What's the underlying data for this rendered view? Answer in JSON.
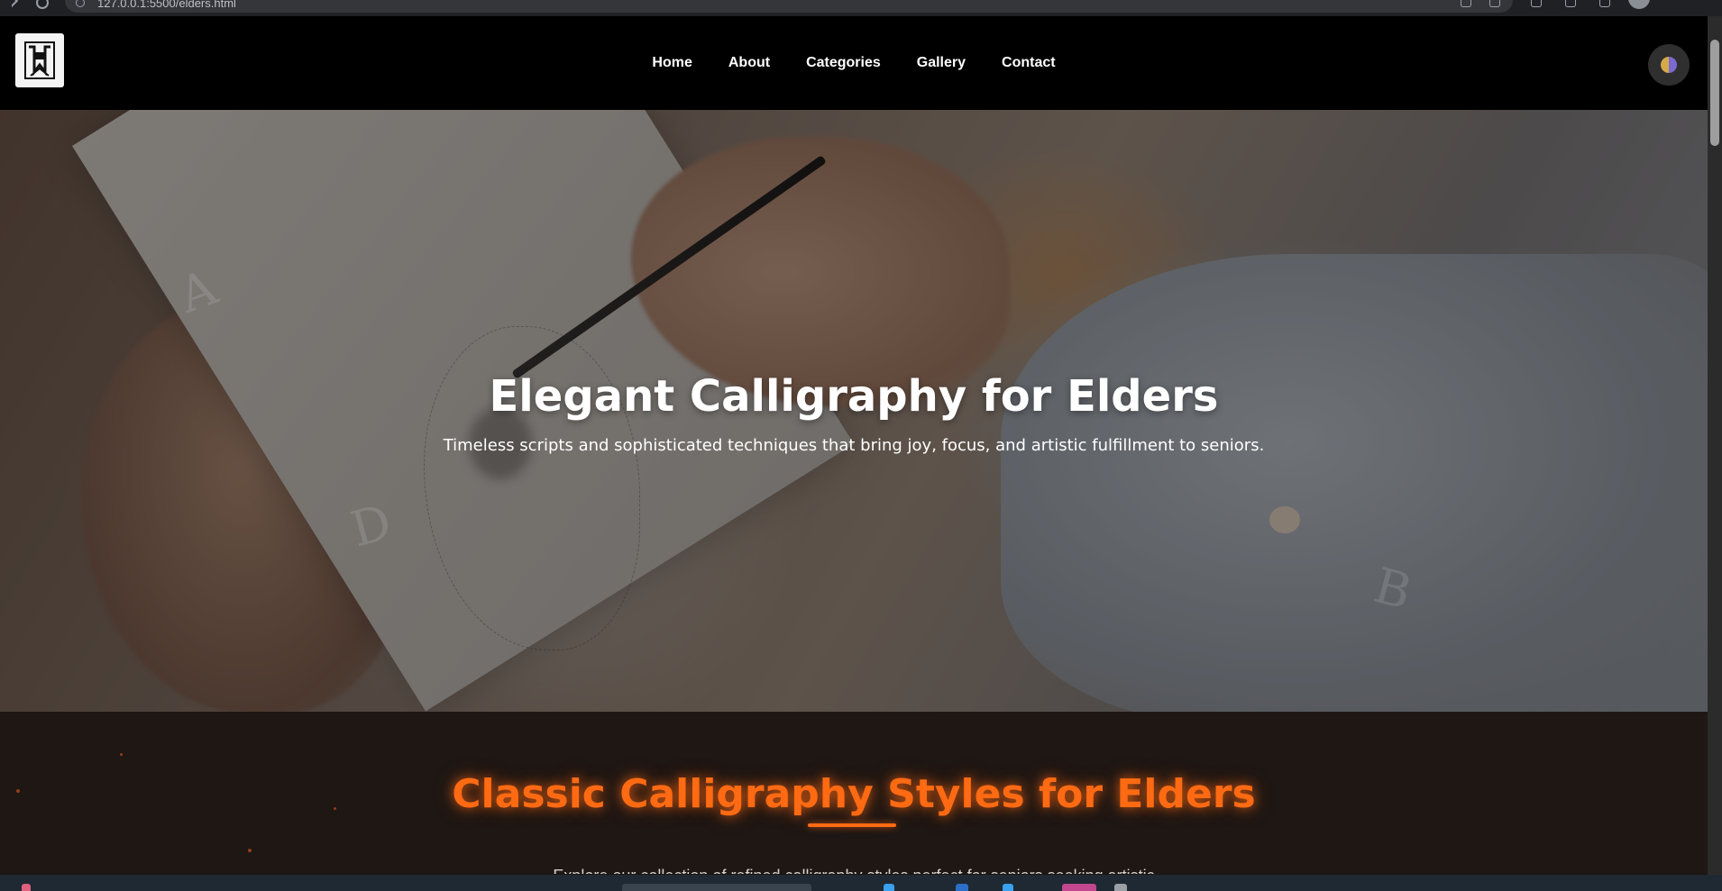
{
  "browser": {
    "url": "127.0.0.1:5500/elders.html"
  },
  "nav": {
    "logo_alt": "Calligraphy logo",
    "links": [
      {
        "label": "Home"
      },
      {
        "label": "About"
      },
      {
        "label": "Categories"
      },
      {
        "label": "Gallery"
      },
      {
        "label": "Contact"
      }
    ]
  },
  "hero": {
    "title": "Elegant Calligraphy for Elders",
    "subtitle": "Timeless scripts and sophisticated techniques that bring joy, focus, and artistic fulfillment to seniors.",
    "decor_letters": [
      "A",
      "D",
      "B"
    ]
  },
  "styles_section": {
    "title": "Classic Calligraphy Styles for Elders",
    "intro": "Explore our collection of refined calligraphy styles perfect for seniors seeking artistic"
  },
  "colors": {
    "accent": "#ff6a13",
    "nav_bg": "#000000",
    "section_bg": "#1e1714"
  }
}
